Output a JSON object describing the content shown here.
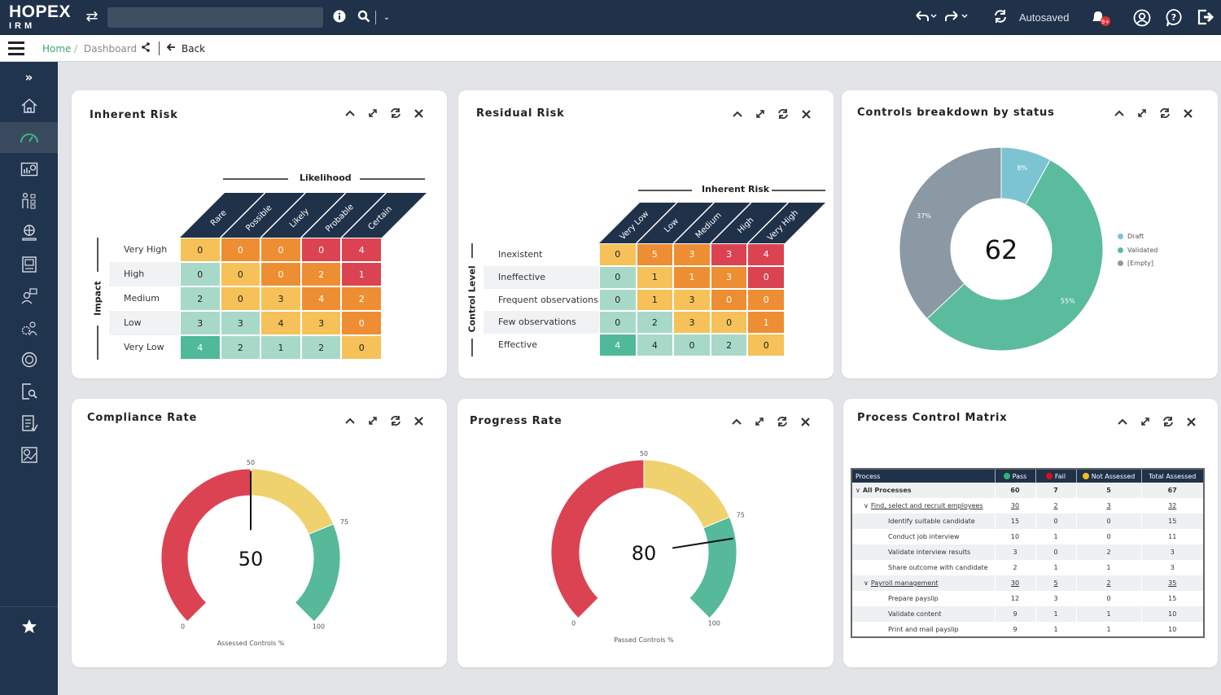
{
  "app": {
    "logo_line1": "HOPEX",
    "logo_line2": "IRM",
    "status": "Autosaved",
    "notification_badge": "9+"
  },
  "search": {
    "placeholder": "",
    "value": ""
  },
  "breadcrumb": {
    "home": "Home",
    "separator": "/",
    "current": "Dashboard",
    "back": "Back"
  },
  "sidebar": {
    "items": [
      {
        "icon": "expand-icon"
      },
      {
        "icon": "home-icon"
      },
      {
        "icon": "dashboard-gauge-icon",
        "active": true
      },
      {
        "icon": "reports-icon"
      },
      {
        "icon": "organization-icon"
      },
      {
        "icon": "globe-hand-icon"
      },
      {
        "icon": "document-icon"
      },
      {
        "icon": "user-chat-icon"
      },
      {
        "icon": "settings-people-icon"
      },
      {
        "icon": "cycle-icon"
      },
      {
        "icon": "document-search-icon"
      },
      {
        "icon": "checklist-icon"
      },
      {
        "icon": "analytics-report-icon"
      }
    ],
    "favorites_icon": "star-icon"
  },
  "widgets": {
    "inherent_risk": {
      "title": "Inherent Risk",
      "x_axis": "Likelihood",
      "y_axis": "Impact",
      "columns": [
        "Rare",
        "Possible",
        "Likely",
        "Probable",
        "Certain"
      ],
      "rows": [
        "Very High",
        "High",
        "Medium",
        "Low",
        "Very Low"
      ],
      "values": [
        [
          0,
          0,
          0,
          0,
          4
        ],
        [
          0,
          0,
          0,
          2,
          1
        ],
        [
          2,
          0,
          3,
          4,
          2
        ],
        [
          3,
          3,
          4,
          3,
          0
        ],
        [
          4,
          2,
          1,
          2,
          0
        ]
      ],
      "levels": [
        [
          "y",
          "o",
          "o",
          "r",
          "r"
        ],
        [
          "g",
          "y",
          "o",
          "o",
          "r"
        ],
        [
          "g",
          "y",
          "y",
          "o",
          "o"
        ],
        [
          "g",
          "g",
          "y",
          "y",
          "o"
        ],
        [
          "G",
          "g",
          "g",
          "g",
          "y"
        ]
      ]
    },
    "residual_risk": {
      "title": "Residual Risk",
      "x_axis": "Inherent Risk",
      "y_axis": "Control Level",
      "columns": [
        "Very Low",
        "Low",
        "Medium",
        "High",
        "Very High"
      ],
      "rows": [
        "Inexistent",
        "Ineffective",
        "Frequent observations",
        "Few observations",
        "Effective"
      ],
      "values": [
        [
          0,
          5,
          3,
          3,
          4
        ],
        [
          0,
          1,
          1,
          3,
          0
        ],
        [
          0,
          1,
          3,
          0,
          0
        ],
        [
          0,
          2,
          3,
          0,
          1
        ],
        [
          4,
          4,
          0,
          2,
          0
        ]
      ],
      "levels": [
        [
          "y",
          "o",
          "o",
          "r",
          "r"
        ],
        [
          "g",
          "y",
          "o",
          "o",
          "r"
        ],
        [
          "g",
          "y",
          "y",
          "o",
          "o"
        ],
        [
          "g",
          "g",
          "y",
          "y",
          "o"
        ],
        [
          "G",
          "g",
          "g",
          "g",
          "y"
        ]
      ]
    },
    "controls_breakdown": {
      "title": "Controls breakdown by status",
      "total": "62"
    },
    "compliance_rate": {
      "title": "Compliance Rate",
      "value": 50,
      "value_label": "50",
      "caption": "Assessed Controls %",
      "ticks": [
        "0",
        "50",
        "75",
        "100"
      ]
    },
    "progress_rate": {
      "title": "Progress Rate",
      "value": 80,
      "value_label": "80",
      "caption": "Passed Controls %",
      "ticks": [
        "0",
        "50",
        "75",
        "100"
      ]
    },
    "process_control_matrix": {
      "title": "Process Control Matrix",
      "headers": [
        "Process",
        "Pass",
        "Fail",
        "Not Assessed",
        "Total Assessed"
      ],
      "rows": [
        {
          "name": "All Processes",
          "level": 0,
          "expand": true,
          "bold": true,
          "link": false,
          "values": [
            "60",
            "7",
            "5",
            "67"
          ]
        },
        {
          "name": "Find, select and recruit employees",
          "level": 1,
          "expand": true,
          "bold": false,
          "link": true,
          "values": [
            "30",
            "2",
            "3",
            "32"
          ]
        },
        {
          "name": "Identify suitable candidate",
          "level": 2,
          "expand": false,
          "bold": false,
          "link": false,
          "values": [
            "15",
            "0",
            "0",
            "15"
          ]
        },
        {
          "name": "Conduct job interview",
          "level": 2,
          "expand": false,
          "bold": false,
          "link": false,
          "values": [
            "10",
            "1",
            "0",
            "11"
          ]
        },
        {
          "name": "Validate interview results",
          "level": 2,
          "expand": false,
          "bold": false,
          "link": false,
          "values": [
            "3",
            "0",
            "2",
            "3"
          ]
        },
        {
          "name": "Share outcome with candidate",
          "level": 2,
          "expand": false,
          "bold": false,
          "link": false,
          "values": [
            "2",
            "1",
            "1",
            "3"
          ]
        },
        {
          "name": "Payroll management",
          "level": 1,
          "expand": true,
          "bold": false,
          "link": true,
          "values": [
            "30",
            "5",
            "2",
            "35"
          ]
        },
        {
          "name": "Prepare payslip",
          "level": 2,
          "expand": false,
          "bold": false,
          "link": false,
          "values": [
            "12",
            "3",
            "0",
            "15"
          ]
        },
        {
          "name": "Validate content",
          "level": 2,
          "expand": false,
          "bold": false,
          "link": false,
          "values": [
            "9",
            "1",
            "1",
            "10"
          ]
        },
        {
          "name": "Print and mail payslip",
          "level": 2,
          "expand": false,
          "bold": false,
          "link": false,
          "values": [
            "9",
            "1",
            "1",
            "10"
          ]
        }
      ]
    }
  },
  "colors": {
    "navy": "#20314a",
    "heat": {
      "G": "#4fb99a",
      "g": "#a8d9c8",
      "y": "#f5c158",
      "o": "#ee8e33",
      "r": "#dc4352"
    },
    "gauge": {
      "red": "#dc4352",
      "yellow": "#efd26e",
      "green": "#55b99a"
    },
    "pass": "#2bb673",
    "fail": "#d7101d",
    "not_assessed": "#f5bf19"
  },
  "chart_data": [
    {
      "type": "pie",
      "title": "Controls breakdown by status",
      "center_label": "62",
      "legend_position": "right",
      "categories": [
        "Draft",
        "Validated",
        "[Empty]"
      ],
      "values": [
        8,
        55,
        37
      ],
      "labels": [
        "8%",
        "55%",
        "37%"
      ],
      "colors": [
        "#7cc4d2",
        "#5bbc9d",
        "#8a99a4"
      ]
    },
    {
      "type": "gauge",
      "title": "Compliance Rate",
      "value": 50,
      "range": [
        0,
        100
      ],
      "bands": [
        {
          "from": 0,
          "to": 50,
          "color": "#dc4352"
        },
        {
          "from": 50,
          "to": 75,
          "color": "#efd26e"
        },
        {
          "from": 75,
          "to": 100,
          "color": "#55b99a"
        }
      ],
      "ticks": [
        0,
        50,
        75,
        100
      ],
      "xlabel": "Assessed Controls %"
    },
    {
      "type": "gauge",
      "title": "Progress Rate",
      "value": 80,
      "range": [
        0,
        100
      ],
      "bands": [
        {
          "from": 0,
          "to": 50,
          "color": "#dc4352"
        },
        {
          "from": 50,
          "to": 75,
          "color": "#efd26e"
        },
        {
          "from": 75,
          "to": 100,
          "color": "#55b99a"
        }
      ],
      "ticks": [
        0,
        50,
        75,
        100
      ],
      "xlabel": "Passed Controls %"
    }
  ]
}
